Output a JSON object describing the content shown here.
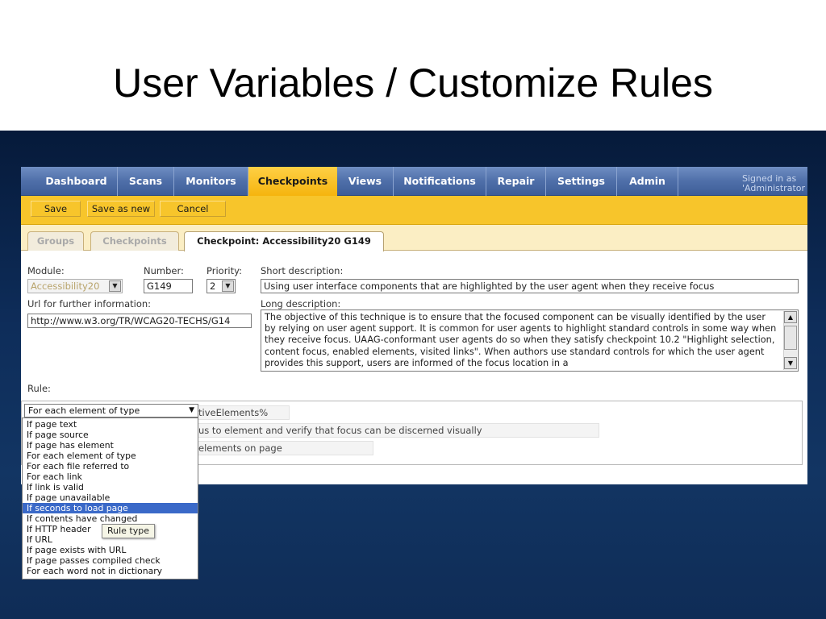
{
  "slide": {
    "title": "User Variables / Customize Rules"
  },
  "nav": {
    "tabs": [
      {
        "label": "Dashboard"
      },
      {
        "label": "Scans"
      },
      {
        "label": "Monitors"
      },
      {
        "label": "Checkpoints",
        "active": true
      },
      {
        "label": "Views"
      },
      {
        "label": "Notifications"
      },
      {
        "label": "Repair"
      },
      {
        "label": "Settings"
      },
      {
        "label": "Admin"
      }
    ],
    "signed_in_line1": "Signed in as",
    "signed_in_line2": "'Administrator"
  },
  "actions": {
    "save": "Save",
    "save_as_new": "Save as new",
    "cancel": "Cancel"
  },
  "subtabs": {
    "groups": "Groups",
    "checkpoints": "Checkpoints",
    "current": "Checkpoint: Accessibility20 G149"
  },
  "form": {
    "module_label": "Module:",
    "module_value": "Accessibility20",
    "number_label": "Number:",
    "number_value": "G149",
    "priority_label": "Priority:",
    "priority_value": "2",
    "short_desc_label": "Short description:",
    "short_desc_value": "Using user interface components that are highlighted by the user agent when they receive focus",
    "url_label": "Url for further information:",
    "url_value": "http://www.w3.org/TR/WCAG20-TECHS/G14",
    "long_desc_label": "Long description:",
    "long_desc_value": "The objective of this technique is to ensure that the focused component can be visually identified by the user by relying on user agent support. It is common for user agents to highlight standard controls in some way when they receive focus. UAAG-conformant user agents do so when they satisfy checkpoint 10.2 \"Highlight selection, content focus, enabled elements, visited links\". When authors use standard controls for which the user agent provides this support, users are informed of the focus location in a"
  },
  "rule": {
    "label": "Rule:",
    "select_value": "For each element of type",
    "row1_value": "tiveElements%",
    "row2_value": "us to element and verify that focus can be discerned visually",
    "row3_value": "elements on page",
    "options": [
      "If page text",
      "If page source",
      "If page has element",
      "For each element of type",
      "For each file referred to",
      "For each link",
      "If link is valid",
      "If page unavailable",
      "If seconds to load page",
      "If contents have changed",
      "If HTTP header",
      "If URL",
      "If page exists with URL",
      "If page passes compiled check",
      "For each word not in dictionary"
    ],
    "selected_index": 8,
    "tooltip": "Rule type"
  },
  "colors": {
    "nav_blue": "#4f6fa9",
    "active_tab": "#f5b40e",
    "action_bar": "#f7c52b",
    "band": "#0e2d5a",
    "selected_option": "#3a69c8"
  }
}
